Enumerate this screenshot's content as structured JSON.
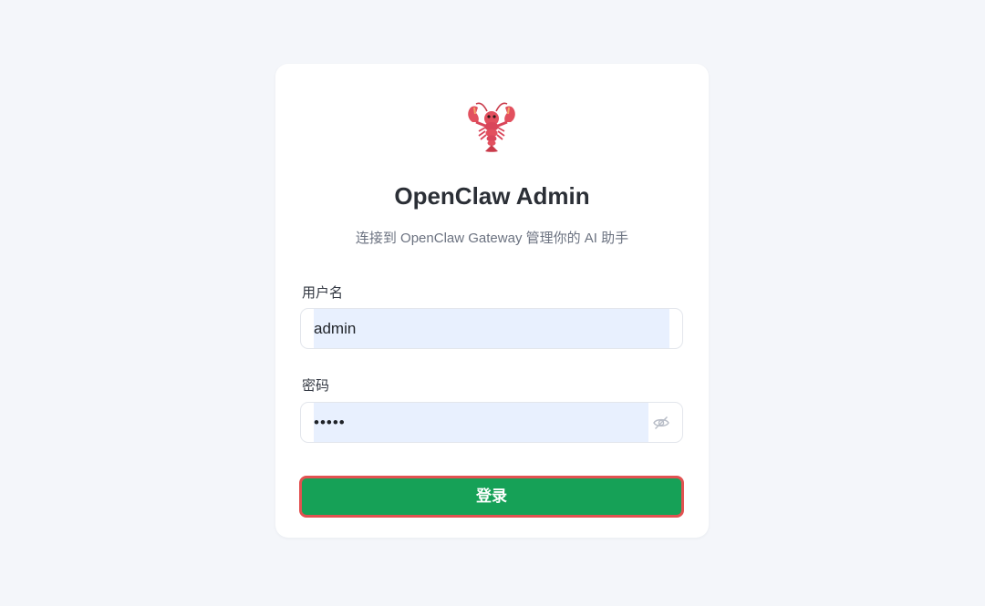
{
  "app": {
    "logo_icon": "lobster-icon",
    "title": "OpenClaw Admin",
    "subtitle": "连接到 OpenClaw Gateway 管理你的 AI 助手"
  },
  "form": {
    "username": {
      "label": "用户名",
      "value": "admin"
    },
    "password": {
      "label": "密码",
      "masked_value": "•••••",
      "toggle_icon": "eye-off-icon"
    },
    "submit_label": "登录"
  },
  "colors": {
    "page_background": "#f4f6fa",
    "card_background": "#ffffff",
    "autofill_background": "#e8f0fe",
    "submit_background": "#16a157",
    "submit_highlight_border": "#e25151"
  }
}
